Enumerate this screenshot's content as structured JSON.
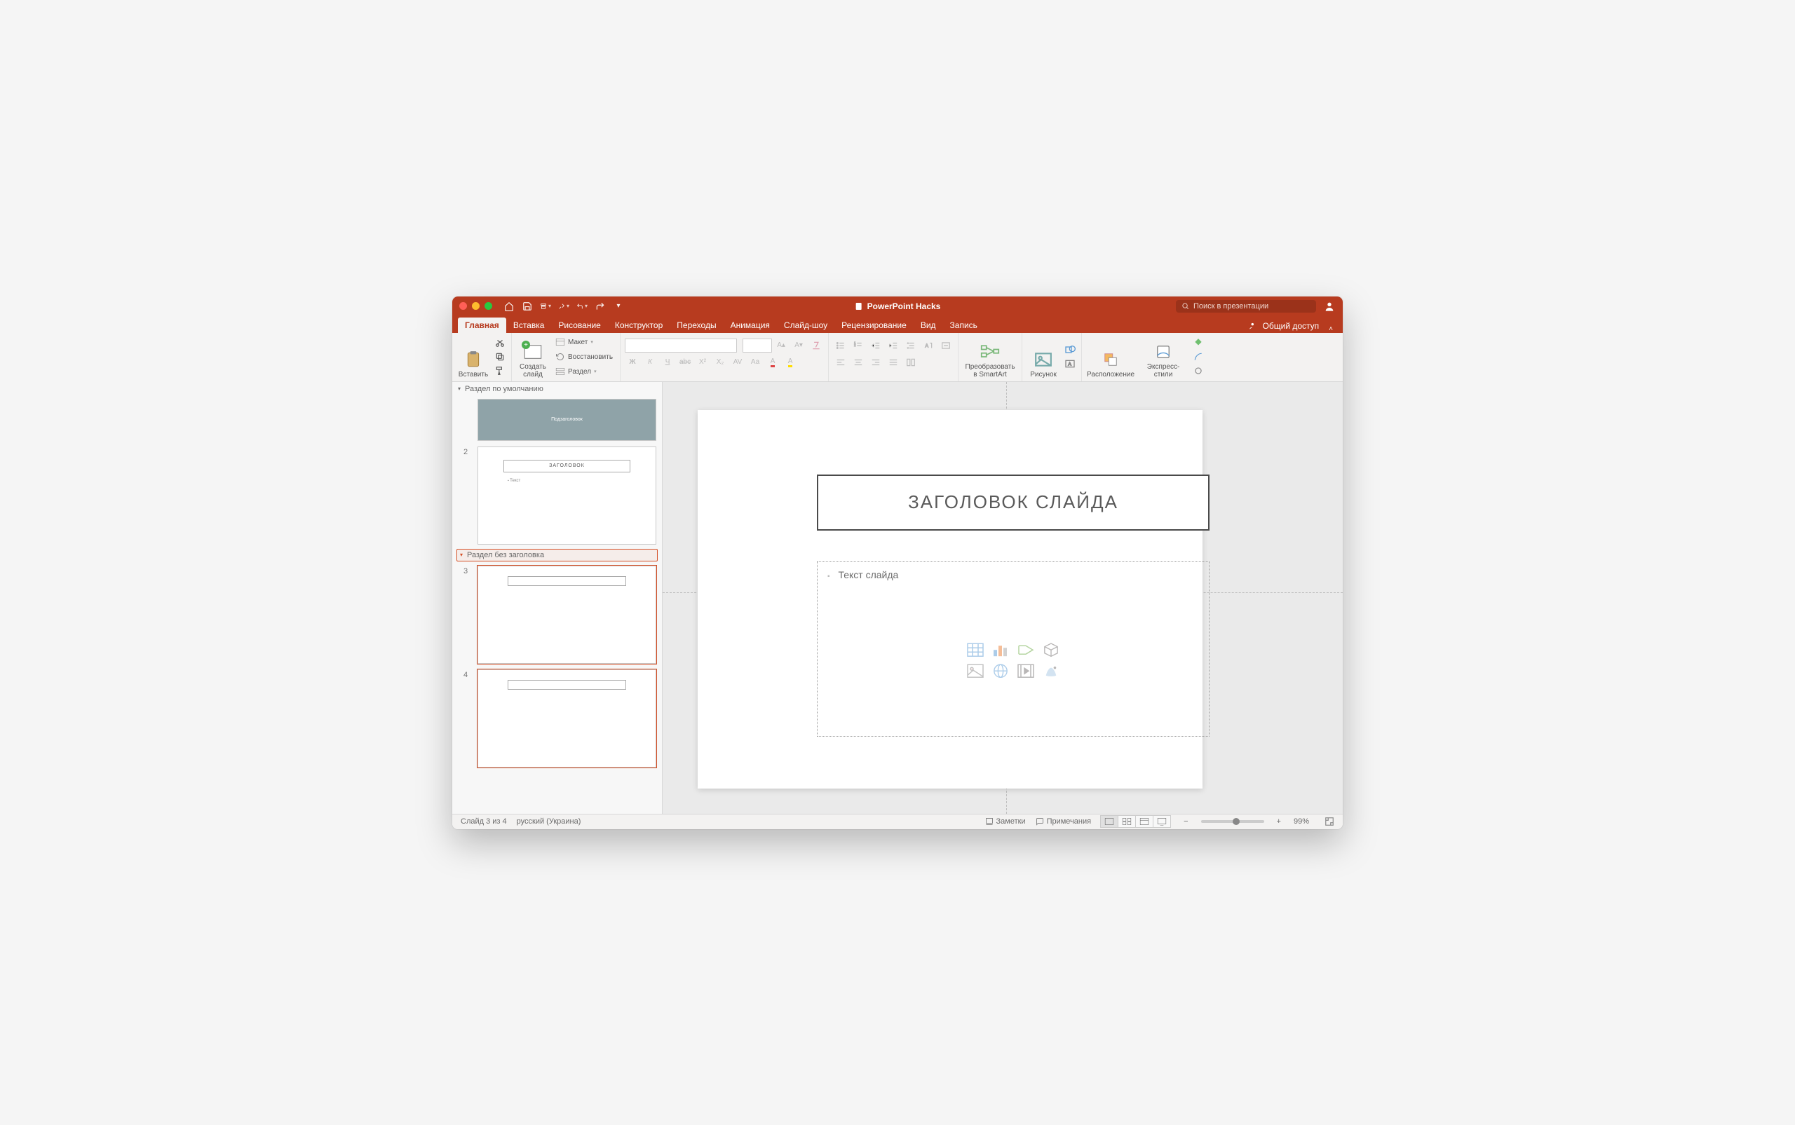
{
  "window": {
    "doc_title": "PowerPoint Hacks",
    "search_placeholder": "Поиск в презентации"
  },
  "tabs": {
    "items": [
      "Главная",
      "Вставка",
      "Рисование",
      "Конструктор",
      "Переходы",
      "Анимация",
      "Слайд-шоу",
      "Рецензирование",
      "Вид",
      "Запись"
    ],
    "active": 0,
    "share_label": "Общий доступ"
  },
  "ribbon": {
    "paste": "Вставить",
    "new_slide": "Создать слайд",
    "layout": "Макет",
    "reset": "Восстановить",
    "section": "Раздел",
    "smartart_l1": "Преобразовать",
    "smartart_l2": "в SmartArt",
    "picture": "Рисунок",
    "arrange": "Расположение",
    "quick_styles": "Экспресс-стили",
    "format_letters": [
      "Ж",
      "К",
      "Ч",
      "abc",
      "X²",
      "X₂",
      "AV",
      "Aa",
      "A"
    ]
  },
  "sections": {
    "s1": "Раздел по умолчанию",
    "s2": "Раздел без заголовка"
  },
  "thumbs": {
    "t1_label": "Подзаголовок",
    "t2_title": "ЗАГОЛОВОК",
    "t2_text": "Текст",
    "n2": "2",
    "n3": "3",
    "n4": "4"
  },
  "slide": {
    "title_placeholder": "ЗАГОЛОВОК СЛАЙДА",
    "body_placeholder": "Текст слайда"
  },
  "status": {
    "slide_pos": "Слайд 3 из 4",
    "language": "русский (Украина)",
    "notes": "Заметки",
    "comments": "Примечания",
    "zoom": "99%",
    "minus": "−",
    "plus": "+"
  }
}
